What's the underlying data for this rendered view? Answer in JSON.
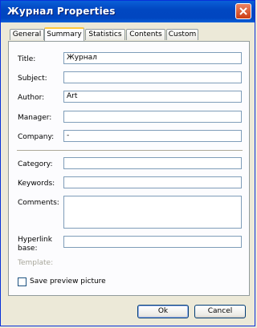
{
  "window": {
    "title": "Журнал Properties"
  },
  "tabs": [
    {
      "label": "General"
    },
    {
      "label": "Summary"
    },
    {
      "label": "Statistics"
    },
    {
      "label": "Contents"
    },
    {
      "label": "Custom"
    }
  ],
  "active_tab": "Summary",
  "fields": {
    "title": {
      "label": "Title:",
      "value": "Журнал"
    },
    "subject": {
      "label": "Subject:",
      "value": ""
    },
    "author": {
      "label": "Author:",
      "value": "Art"
    },
    "manager": {
      "label": "Manager:",
      "value": ""
    },
    "company": {
      "label": "Company:",
      "value": "-"
    },
    "category": {
      "label": "Category:",
      "value": ""
    },
    "keywords": {
      "label": "Keywords:",
      "value": ""
    },
    "comments": {
      "label": "Comments:",
      "value": ""
    },
    "hyperlink_base": {
      "label_line1": "Hyperlink",
      "label_line2": "base:",
      "value": ""
    },
    "template": {
      "label": "Template:"
    }
  },
  "save_preview": {
    "label": "Save preview picture",
    "checked": false
  },
  "buttons": {
    "ok": "Ok",
    "cancel": "Cancel"
  },
  "colors": {
    "titlebar": "#0147c1",
    "face": "#ece9d8",
    "panel": "#fcfcfe",
    "close": "#cc3d14",
    "tab_highlight": "#ffc83c"
  }
}
